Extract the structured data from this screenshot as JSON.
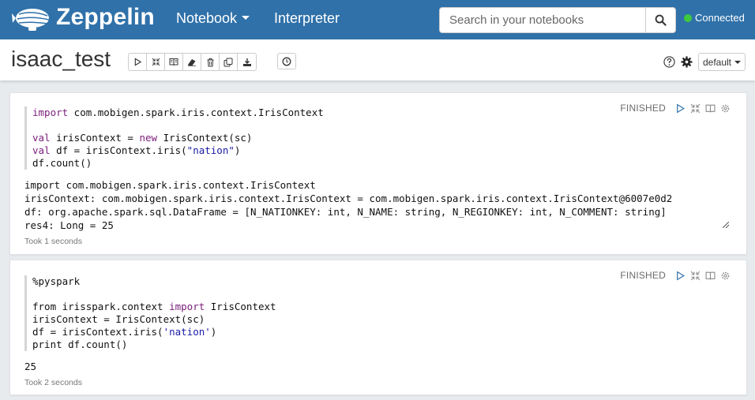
{
  "navbar": {
    "brand": "Zeppelin",
    "notebook_menu": "Notebook",
    "interpreter_link": "Interpreter",
    "search_placeholder": "Search in your notebooks",
    "status": "Connected",
    "status_color": "#3fc93f",
    "bg_color": "#3071a9"
  },
  "header": {
    "title": "isaac_test",
    "toolbar_icons": [
      "run-all-icon",
      "hide-editor-icon",
      "hide-output-icon",
      "clear-output-icon",
      "delete-icon",
      "clone-icon",
      "export-icon"
    ],
    "schedule_icon": "clock-icon",
    "help_icon": "question-icon",
    "settings_icon": "gear-icon",
    "interpreter_binding": "default"
  },
  "paragraphs": [
    {
      "status": "FINISHED",
      "code": [
        [
          {
            "t": "import",
            "c": "kw"
          },
          {
            "t": " com.mobigen.spark.iris.context.IrisContext",
            "c": ""
          }
        ],
        [],
        [
          {
            "t": "val",
            "c": "kw"
          },
          {
            "t": " irisContext = ",
            "c": ""
          },
          {
            "t": "new",
            "c": "kw"
          },
          {
            "t": " IrisContext(sc)",
            "c": ""
          }
        ],
        [
          {
            "t": "val",
            "c": "kw"
          },
          {
            "t": " df = irisContext.iris(",
            "c": ""
          },
          {
            "t": "\"nation\"",
            "c": "str"
          },
          {
            "t": ")",
            "c": ""
          }
        ],
        [
          {
            "t": "df.count()",
            "c": ""
          }
        ]
      ],
      "output": [
        "import com.mobigen.spark.iris.context.IrisContext",
        "irisContext: com.mobigen.spark.iris.context.IrisContext = com.mobigen.spark.iris.context.IrisContext@6007e0d2",
        "df: org.apache.spark.sql.DataFrame = [N_NATIONKEY: int, N_NAME: string, N_REGIONKEY: int, N_COMMENT: string]",
        "res4: Long = 25"
      ],
      "took": "Took 1 seconds"
    },
    {
      "status": "FINISHED",
      "code": [
        [
          {
            "t": "%pyspark",
            "c": ""
          }
        ],
        [],
        [
          {
            "t": "from irisspark.context ",
            "c": ""
          },
          {
            "t": "import",
            "c": "kw"
          },
          {
            "t": " IrisContext",
            "c": ""
          }
        ],
        [
          {
            "t": "irisContext = IrisContext(sc)",
            "c": ""
          }
        ],
        [
          {
            "t": "df = irisContext.iris(",
            "c": ""
          },
          {
            "t": "'nation'",
            "c": "str"
          },
          {
            "t": ")",
            "c": ""
          }
        ],
        [
          {
            "t": "print df.count()",
            "c": ""
          }
        ]
      ],
      "output": [
        "25"
      ],
      "took": "Took 2 seconds"
    }
  ]
}
